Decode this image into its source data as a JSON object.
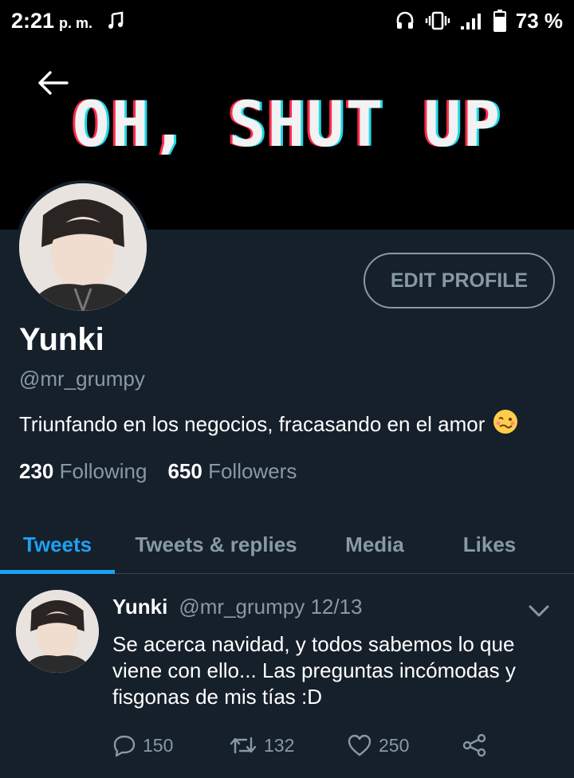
{
  "status_bar": {
    "time": "2:21",
    "ampm": "p. m.",
    "battery": "73 %"
  },
  "banner": {
    "text": "OH, SHUT UP"
  },
  "profile": {
    "edit_label": "EDIT PROFILE",
    "name": "Yunki",
    "handle": "@mr_grumpy",
    "bio": "Triunfando en los negocios, fracasando en el amor",
    "bio_emoji": "🥴",
    "following_count": "230",
    "following_label": "Following",
    "followers_count": "650",
    "followers_label": "Followers"
  },
  "tabs": [
    {
      "label": "Tweets",
      "active": true
    },
    {
      "label": "Tweets & replies",
      "active": false
    },
    {
      "label": "Media",
      "active": false
    },
    {
      "label": "Likes",
      "active": false
    }
  ],
  "tweet": {
    "name": "Yunki",
    "meta": "@mr_grumpy 12/13",
    "text": "Se acerca navidad, y todos sabemos lo que viene con ello... Las preguntas incómodas y fisgonas de mis tías :D",
    "replies": "150",
    "retweets": "132",
    "likes": "250"
  },
  "colors": {
    "background": "#15202b",
    "accent": "#1da1f2",
    "muted": "#8899a6"
  }
}
